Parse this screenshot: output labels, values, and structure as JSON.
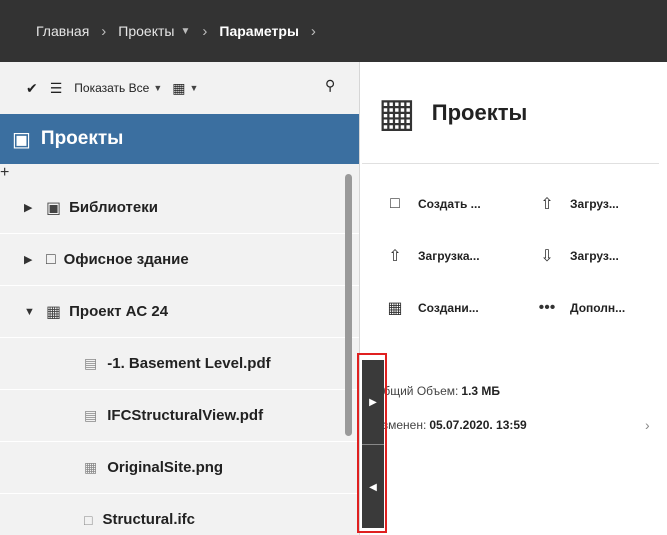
{
  "breadcrumb": {
    "items": [
      "Главная",
      "Проекты",
      "Параметры"
    ]
  },
  "toolbar": {
    "show_all": "Показать Все"
  },
  "left_header": {
    "title": "Проекты"
  },
  "tree": {
    "items": [
      {
        "label": "Библиотеки",
        "icon": "library-folder-icon"
      },
      {
        "label": "Офисное здание",
        "icon": "folder-icon"
      },
      {
        "label": "Проект AC 24",
        "icon": "building-project-icon"
      },
      {
        "label": "-1. Basement Level.pdf",
        "icon": "pdf-file-icon"
      },
      {
        "label": "IFCStructuralView.pdf",
        "icon": "pdf-file-icon"
      },
      {
        "label": "OriginalSite.png",
        "icon": "image-file-icon"
      },
      {
        "label": "Structural.ifc",
        "icon": "file-icon"
      }
    ]
  },
  "right": {
    "title": "Проекты",
    "actions": [
      "Создать ...",
      "Загруз...",
      "Загрузка...",
      "Загруз...",
      "Создани...",
      "Дополн..."
    ],
    "size_label": "Общий Объем:",
    "size_value": "1.3 МБ",
    "modified_label": "Изменен:",
    "modified_value": "05.07.2020. 13:59"
  },
  "colors": {
    "topbar": "#333333",
    "header": "#3b6fa0",
    "highlight": "#e02020"
  }
}
